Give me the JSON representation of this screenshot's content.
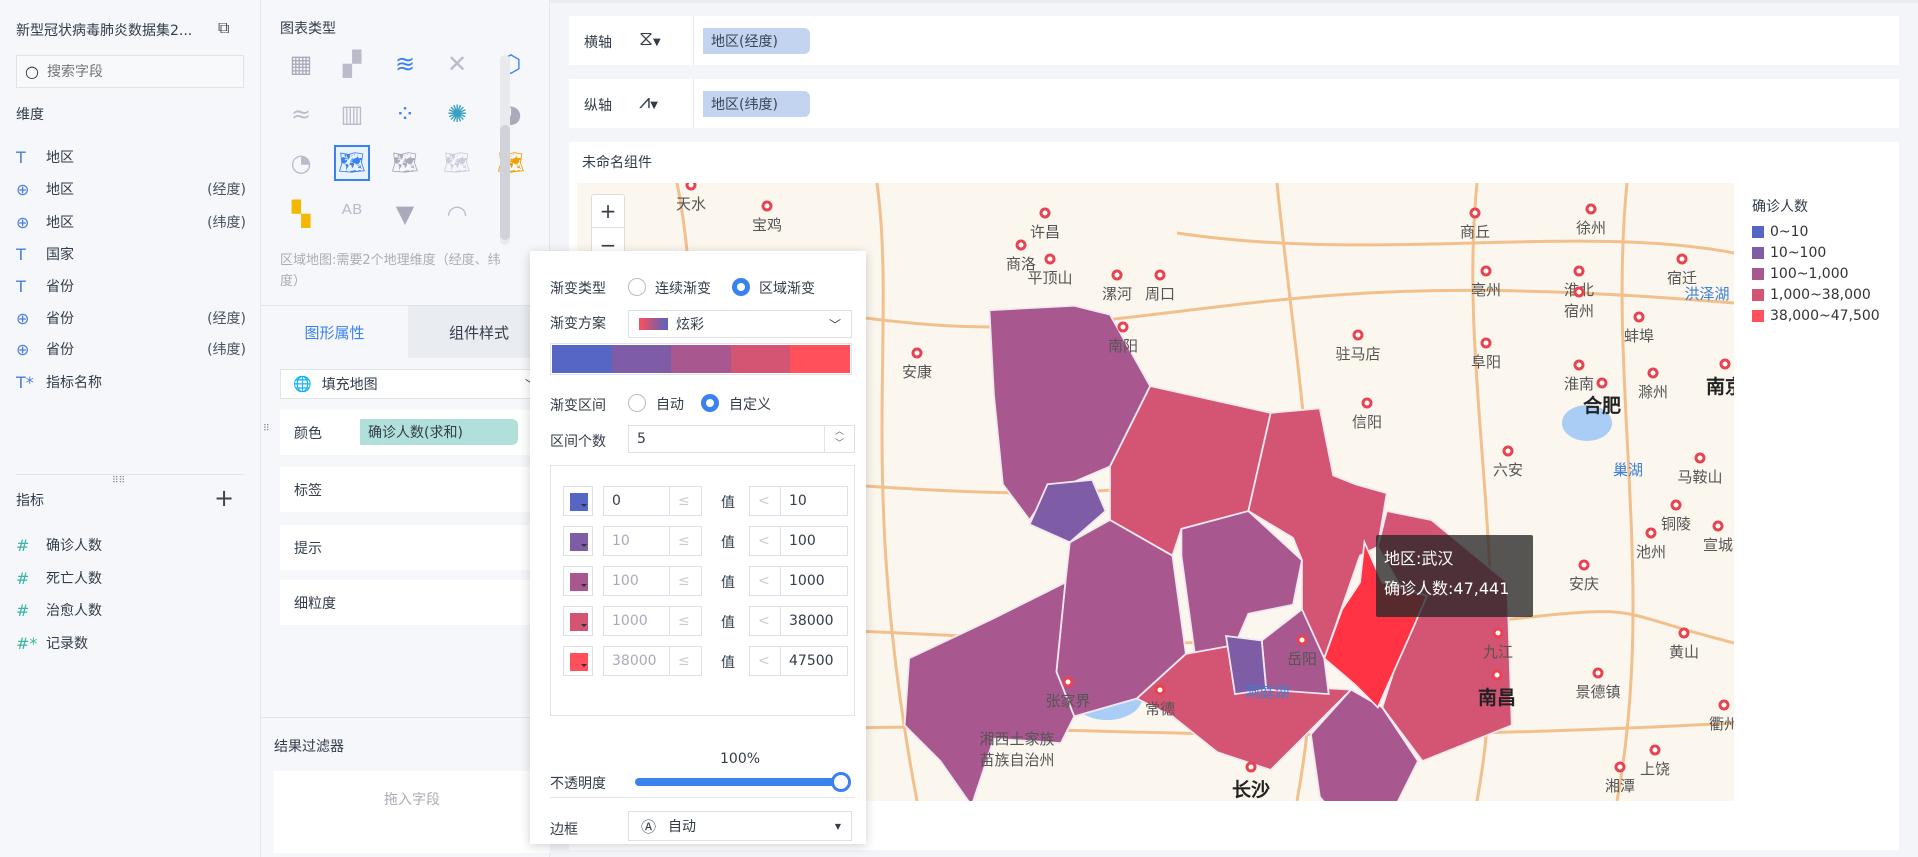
{
  "left": {
    "dataset_title": "新型冠状病毒肺炎数据集2...",
    "search_placeholder": "搜索字段",
    "dimensions_label": "维度",
    "dimensions": [
      {
        "icon": "text-icon",
        "name": "地区",
        "suffix": ""
      },
      {
        "icon": "globe-icon",
        "name": "地区",
        "suffix": "(经度)"
      },
      {
        "icon": "globe-icon",
        "name": "地区",
        "suffix": "(纬度)"
      },
      {
        "icon": "text-icon",
        "name": "国家",
        "suffix": ""
      },
      {
        "icon": "text-icon",
        "name": "省份",
        "suffix": ""
      },
      {
        "icon": "globe-icon",
        "name": "省份",
        "suffix": "(经度)"
      },
      {
        "icon": "globe-icon",
        "name": "省份",
        "suffix": "(纬度)"
      },
      {
        "icon": "text-calc-icon",
        "name": "指标名称",
        "suffix": ""
      }
    ],
    "measures_label": "指标",
    "measures": [
      {
        "icon": "#",
        "name": "确诊人数"
      },
      {
        "icon": "#",
        "name": "死亡人数"
      },
      {
        "icon": "#",
        "name": "治愈人数"
      },
      {
        "icon": "#*",
        "name": "记录数"
      }
    ]
  },
  "mid": {
    "chart_type_label": "图表类型",
    "selected_chart": "filled-map",
    "hint": "区域地图:需要2个地理维度（经度、纬度）",
    "tabs": [
      "图形属性",
      "组件样式"
    ],
    "map_type": "填充地图",
    "color_label": "颜色",
    "color_field": "确诊人数(求和)",
    "label_label": "标签",
    "tooltip_label": "提示",
    "granularity_label": "细粒度",
    "filter_label": "结果过滤器",
    "filter_drop": "拖入字段"
  },
  "axes": {
    "x_label": "横轴",
    "x_field": "地区(经度)",
    "y_label": "纵轴",
    "y_field": "地区(纬度)"
  },
  "component_title": "未命名组件",
  "popup": {
    "gradient_type_label": "渐变类型",
    "gradient_types": [
      "连续渐变",
      "区域渐变"
    ],
    "gradient_type_selected": "区域渐变",
    "scheme_label": "渐变方案",
    "scheme": "炫彩",
    "range_label": "渐变区间",
    "range_modes": [
      "自动",
      "自定义"
    ],
    "range_mode_selected": "自定义",
    "count_label": "区间个数",
    "count": "5",
    "value_label": "值",
    "ranges": [
      {
        "color": "#5566c4",
        "min": "0",
        "op1": "≤",
        "op2": "<",
        "max": "10"
      },
      {
        "color": "#7f5ca6",
        "min": "10",
        "op1": "≤",
        "op2": "<",
        "max": "100"
      },
      {
        "color": "#a8588e",
        "min": "100",
        "op1": "≤",
        "op2": "<",
        "max": "1000"
      },
      {
        "color": "#d45474",
        "min": "1000",
        "op1": "≤",
        "op2": "<",
        "max": "38000"
      },
      {
        "color": "#ff505c",
        "min": "38000",
        "op1": "≤",
        "op2": "<",
        "max": "47500"
      }
    ],
    "opacity_label": "不透明度",
    "opacity": "100%",
    "opacity_value": 100,
    "border_label": "边框",
    "border_value": "自动"
  },
  "legend": {
    "title": "确诊人数",
    "items": [
      {
        "label": "0~10",
        "color": "#5566c4"
      },
      {
        "label": "10~100",
        "color": "#7f5ca6"
      },
      {
        "label": "100~1,000",
        "color": "#a8588e"
      },
      {
        "label": "1,000~38,000",
        "color": "#d45474"
      },
      {
        "label": "38,000~47,500",
        "color": "#ff505c"
      }
    ]
  },
  "tooltip": {
    "line1": "地区:武汉",
    "line2": "确诊人数:47,441"
  },
  "map": {
    "zoom_in": "+",
    "zoom_out": "−",
    "cities": [
      "天水",
      "宝鸡",
      "商洛",
      "许昌",
      "平顶山",
      "漯河",
      "周口",
      "商丘",
      "徐州",
      "淮北",
      "宿迁",
      "亳州",
      "宿州",
      "洪泽湖",
      "南阳",
      "驻马店",
      "阜阳",
      "蚌埠",
      "淮南",
      "滁州",
      "安康",
      "合肥",
      "南京",
      "六安",
      "巢湖",
      "马鞍山",
      "铜陵",
      "池州",
      "宣城",
      "安庆",
      "九江",
      "景德镇",
      "黄山",
      "南昌",
      "岳阳",
      "洞庭湖",
      "张家界",
      "常德",
      "湘西土家族",
      "苗族自治州",
      "长沙",
      "湘潭",
      "上饶",
      "衢州",
      "信阳"
    ]
  }
}
